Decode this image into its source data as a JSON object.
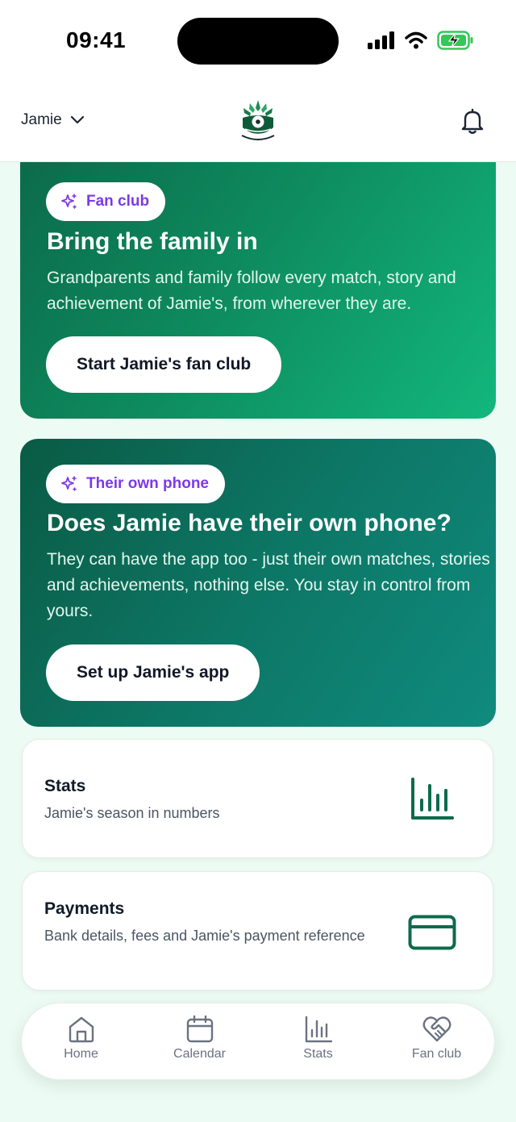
{
  "status_bar": {
    "time": "09:41"
  },
  "header": {
    "child_name": "Jamie"
  },
  "fan_club_promo": {
    "badge": "Fan club",
    "title": "Bring the family in",
    "text": "Grandparents and family follow every match, story and achievement of Jamie's, from wherever they are.",
    "button": "Start Jamie's fan club"
  },
  "phone_promo": {
    "badge": "Their own phone",
    "title": "Does Jamie have their own phone?",
    "text": "They can have the app too - just their own matches, stories and achievements, nothing else. You stay in control from yours.",
    "button": "Set up Jamie's app"
  },
  "cards": {
    "stats": {
      "title": "Stats",
      "subtitle": "Jamie's season in numbers",
      "icon": "bar-chart-icon"
    },
    "payments": {
      "title": "Payments",
      "subtitle": "Bank details, fees and Jamie's payment reference",
      "icon": "credit-card-icon"
    }
  },
  "tabbar": {
    "items": [
      {
        "label": "Home",
        "icon": "home-icon"
      },
      {
        "label": "Calendar",
        "icon": "calendar-icon"
      },
      {
        "label": "Stats",
        "icon": "bar-chart-icon"
      },
      {
        "label": "Fan club",
        "icon": "heart-handshake-icon"
      }
    ]
  },
  "colors": {
    "accent_green": "#0d6b4b",
    "badge_purple": "#7c3ae6",
    "background": "#ecfbf4"
  }
}
